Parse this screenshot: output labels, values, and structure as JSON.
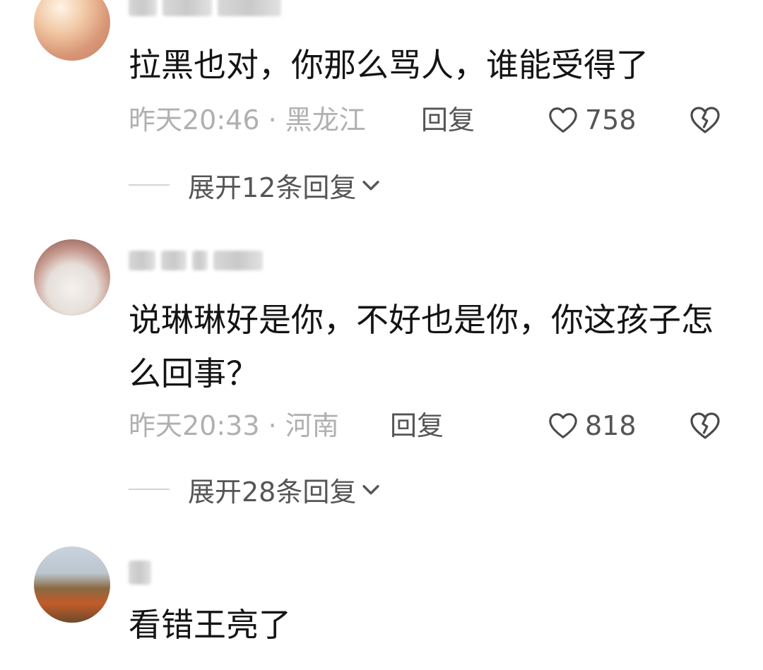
{
  "comments": [
    {
      "text": "拉黑也对，你那么骂人，谁能受得了",
      "time": "昨天20:46",
      "location": "黑龙江",
      "reply_label": "回复",
      "likes": "758",
      "expand": "展开12条回复"
    },
    {
      "text": "说琳琳好是你，不好也是你，你这孩子怎么回事？",
      "time": "昨天20:33",
      "location": "河南",
      "reply_label": "回复",
      "likes": "818",
      "expand": "展开28条回复"
    },
    {
      "text": "看错王亮了"
    }
  ],
  "meta_separator": " · ",
  "icons": {
    "like": "heart-outline-icon",
    "dislike": "broken-heart-icon",
    "expand": "chevron-down-icon"
  },
  "colors": {
    "meta_text": "#b0b0b0",
    "action_text": "#555555",
    "body_text": "#141414"
  }
}
